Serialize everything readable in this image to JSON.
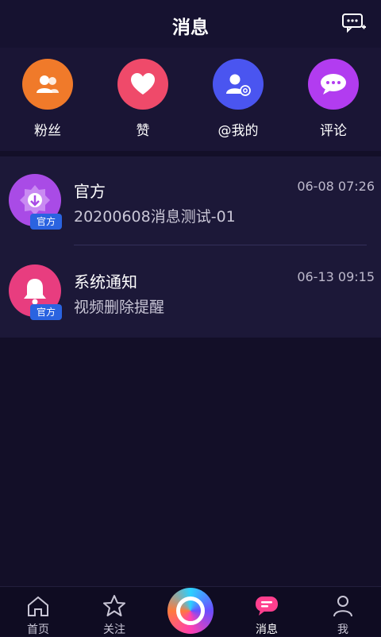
{
  "header": {
    "title": "消息"
  },
  "quick": [
    {
      "label": "粉丝",
      "icon": "fans-icon",
      "color": "#f07a2a"
    },
    {
      "label": "赞",
      "icon": "heart-icon",
      "color": "#ef4a6a"
    },
    {
      "label": "@我的",
      "icon": "mention-icon",
      "color": "#4a55f0"
    },
    {
      "label": "评论",
      "icon": "comment-icon",
      "color": "#b23cf0"
    }
  ],
  "messages": [
    {
      "name": "官方",
      "text": "20200608消息测试-01",
      "time": "06-08 07:26",
      "badge": "官方",
      "icon": "award-icon",
      "color": "#a94be6"
    },
    {
      "name": "系统通知",
      "text": "视频删除提醒",
      "time": "06-13 09:15",
      "badge": "官方",
      "icon": "bell-icon",
      "color": "#e83d7f"
    }
  ],
  "tabs": [
    {
      "label": "首页",
      "icon": "home-icon"
    },
    {
      "label": "关注",
      "icon": "star-icon"
    },
    {
      "label": "",
      "icon": "camera-icon"
    },
    {
      "label": "消息",
      "icon": "message-icon",
      "active": true
    },
    {
      "label": "我",
      "icon": "profile-icon"
    }
  ]
}
